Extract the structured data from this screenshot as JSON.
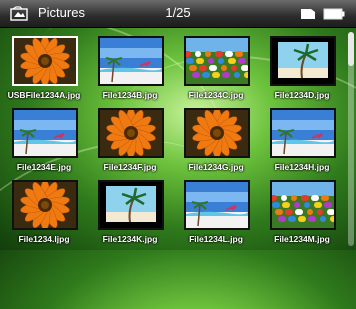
{
  "header": {
    "title": "Pictures",
    "counter": "1/25",
    "icons": [
      "folder-icon",
      "sd-card-icon",
      "battery-icon"
    ]
  },
  "files": [
    {
      "name": "USBFile1234A.jpg",
      "thumb": "flower-icon",
      "selected": true
    },
    {
      "name": "File1234B.jpg",
      "thumb": "beach-icon",
      "selected": false
    },
    {
      "name": "File1234C.jpg",
      "thumb": "flowerbed-icon",
      "selected": false
    },
    {
      "name": "File1234D.jpg",
      "thumb": "palm-icon",
      "selected": false
    },
    {
      "name": "File1234E.jpg",
      "thumb": "beach-icon",
      "selected": false
    },
    {
      "name": "File1234F.jpg",
      "thumb": "flower-icon",
      "selected": false
    },
    {
      "name": "File1234G.jpg",
      "thumb": "flower-icon",
      "selected": false
    },
    {
      "name": "File1234H.jpg",
      "thumb": "beach-icon",
      "selected": false
    },
    {
      "name": "File1234.Ijpg",
      "thumb": "flower-icon",
      "selected": false
    },
    {
      "name": "File1234K.jpg",
      "thumb": "palm-icon",
      "selected": false
    },
    {
      "name": "File1234L.jpg",
      "thumb": "beach-icon",
      "selected": false
    },
    {
      "name": "File1234M.jpg",
      "thumb": "flowerbed-icon",
      "selected": false
    }
  ],
  "colors": {
    "background": "#4fa32a",
    "titlebar": "#2c2c2c",
    "selection": "#ffffff"
  }
}
